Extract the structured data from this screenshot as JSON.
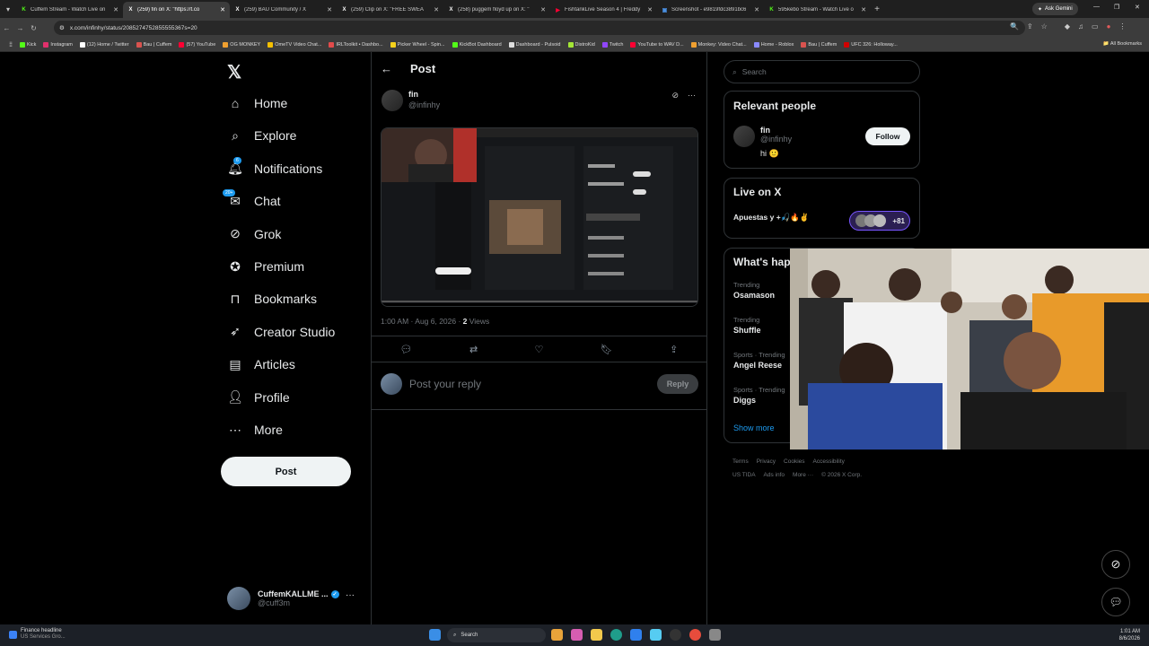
{
  "browser": {
    "tabs": [
      {
        "label": "Cuffem Stream - Watch Live on",
        "icon": "kick-icon",
        "color": "#53fc18",
        "letter": "K",
        "active": false
      },
      {
        "label": "(259) fin on X: \"https://t.co",
        "icon": "x-icon",
        "color": "#ffffff",
        "letter": "X",
        "active": true
      },
      {
        "label": "(259) BAU Community / X",
        "icon": "x-icon",
        "color": "#ffffff",
        "letter": "X",
        "active": false
      },
      {
        "label": "(259) Clip on X: \"FREE SWEA",
        "icon": "x-icon",
        "color": "#ffffff",
        "letter": "X",
        "active": false
      },
      {
        "label": "(258) puggem floyd up on X: \"",
        "icon": "x-icon",
        "color": "#ffffff",
        "letter": "X",
        "active": false
      },
      {
        "label": "FishtankLive Season 4 | Freddy",
        "icon": "youtube-icon",
        "color": "#ff0033",
        "letter": "▶",
        "active": false
      },
      {
        "label": "Screenshot - e9819fdc3891bc6",
        "icon": "image-icon",
        "color": "#4a90e2",
        "letter": "▣",
        "active": false
      },
      {
        "label": "595kebo Stream - Watch Live o",
        "icon": "kick-icon",
        "color": "#53fc18",
        "letter": "K",
        "active": false
      }
    ],
    "new_tab": "+",
    "ask_gemini": "Ask Gemini",
    "url": "x.com/infinhy/status/2085274752855555367s=20",
    "bookmarks": [
      {
        "label": "Kick",
        "color": "#53fc18"
      },
      {
        "label": "Instagram",
        "color": "#e1306c"
      },
      {
        "label": "(12) Home / Twitter",
        "color": "#ffffff"
      },
      {
        "label": "Bau | Cuffem",
        "color": "#d9534f"
      },
      {
        "label": "(57) YouTube",
        "color": "#ff0033"
      },
      {
        "label": "OG MONKEY",
        "color": "#f0a030"
      },
      {
        "label": "OmeTV Video Chat...",
        "color": "#f5c000"
      },
      {
        "label": "IRLToolkit • Dashbo...",
        "color": "#e24b4b"
      },
      {
        "label": "Picker Wheel - Spin...",
        "color": "#f7d21c"
      },
      {
        "label": "KickBot Dashboard",
        "color": "#53fc18"
      },
      {
        "label": "Dashboard - Pulsoid",
        "color": "#dddddd"
      },
      {
        "label": "DistroKid",
        "color": "#a3e635"
      },
      {
        "label": "Twitch",
        "color": "#9146ff"
      },
      {
        "label": "YouTube to WAV D...",
        "color": "#ff0033"
      },
      {
        "label": "Monkey: Video Chat...",
        "color": "#f0a030"
      },
      {
        "label": "Home - Roblox",
        "color": "#8a8aff"
      },
      {
        "label": "Bau | Cuffem",
        "color": "#d9534f"
      },
      {
        "label": "UFC 326: Holloway...",
        "color": "#d00000"
      }
    ],
    "all_bookmarks": "All Bookmarks"
  },
  "nav": {
    "items": [
      {
        "label": "Home",
        "icon": "home-icon"
      },
      {
        "label": "Explore",
        "icon": "search-icon"
      },
      {
        "label": "Notifications",
        "icon": "bell-icon",
        "badge": "6"
      },
      {
        "label": "Chat",
        "icon": "chat-icon",
        "badge": "20+"
      },
      {
        "label": "Grok",
        "icon": "grok-icon"
      },
      {
        "label": "Premium",
        "icon": "premium-icon"
      },
      {
        "label": "Bookmarks",
        "icon": "bookmark-icon"
      },
      {
        "label": "Creator Studio",
        "icon": "rocket-icon"
      },
      {
        "label": "Articles",
        "icon": "article-icon"
      },
      {
        "label": "Profile",
        "icon": "profile-icon"
      },
      {
        "label": "More",
        "icon": "more-circle-icon"
      }
    ],
    "post_button": "Post",
    "account": {
      "name": "CuffemKALLME ...",
      "handle": "@cuff3m"
    }
  },
  "main": {
    "header": "Post",
    "author": {
      "name": "fin",
      "handle": "@infinhy"
    },
    "timestamp": "1:00 AM · Aug 6, 2026 · ",
    "views_count": "2",
    "views_label": " Views",
    "reply_placeholder": "Post your reply",
    "reply_button": "Reply"
  },
  "sidebar": {
    "search_placeholder": "Search",
    "relevant_people": {
      "title": "Relevant people",
      "name": "fin",
      "handle": "@infinhy",
      "bio": "hi 🙂",
      "follow": "Follow"
    },
    "live": {
      "title": "Live on X",
      "stream_title": "Apuestas y +🎣🔥✌️",
      "viewer_extra": "+81"
    },
    "happening": {
      "title": "What's hap",
      "trends": [
        {
          "category": "Trending",
          "topic": "Osamason"
        },
        {
          "category": "Trending",
          "topic": "Shuffle"
        },
        {
          "category": "Sports · Trending",
          "topic": "Angel Reese"
        },
        {
          "category": "Sports · Trending",
          "topic": "Diggs"
        }
      ],
      "show_more": "Show more"
    },
    "footer": [
      "Terms",
      "Privacy",
      "Cookies",
      "Accessibility",
      "US TIDA",
      "Ads info",
      "More ···",
      "© 2026 X Corp."
    ]
  },
  "taskbar": {
    "news_title": "Finance headline",
    "news_sub": "US Services Gro...",
    "search": "Search",
    "time": "1:01 AM",
    "date": "8/6/2026"
  },
  "colors": {
    "accent": "#1d9bf0",
    "background": "#000000",
    "border": "#2f3336",
    "muted": "#71767b"
  }
}
